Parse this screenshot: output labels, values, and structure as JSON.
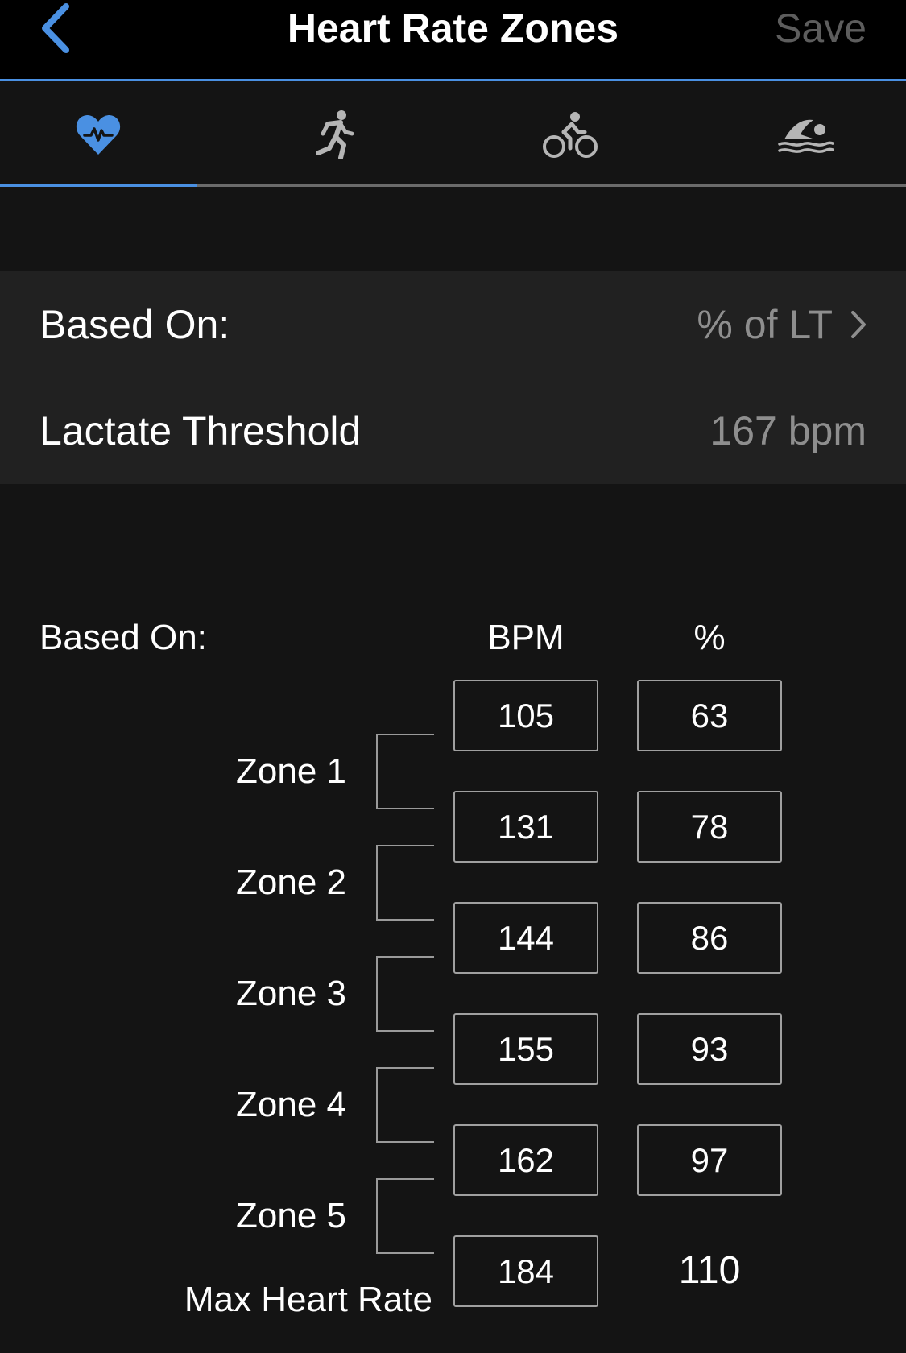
{
  "nav": {
    "title": "Heart Rate Zones",
    "save_label": "Save",
    "back_icon": "chevron-left-icon"
  },
  "tabs": [
    {
      "icon": "heart-rate-icon",
      "active": true
    },
    {
      "icon": "running-icon",
      "active": false
    },
    {
      "icon": "cycling-icon",
      "active": false
    },
    {
      "icon": "swimming-icon",
      "active": false
    }
  ],
  "settings": {
    "based_on_label": "Based On:",
    "based_on_value": "% of LT",
    "lactate_label": "Lactate Threshold",
    "lactate_value": "167 bpm"
  },
  "zones": {
    "based_on_label": "Based On:",
    "bpm_header": "BPM",
    "pct_header": "%",
    "bpm_values": [
      "105",
      "131",
      "144",
      "155",
      "162",
      "184"
    ],
    "pct_values": [
      "63",
      "78",
      "86",
      "93",
      "97"
    ],
    "max_pct": "110",
    "zone_labels": [
      "Zone 1",
      "Zone 2",
      "Zone 3",
      "Zone 4",
      "Zone 5"
    ],
    "max_label": "Max Heart Rate"
  },
  "colors": {
    "accent": "#4a90e2",
    "background": "#141414",
    "row_background": "#212121",
    "secondary_text": "#8e8e8e"
  }
}
